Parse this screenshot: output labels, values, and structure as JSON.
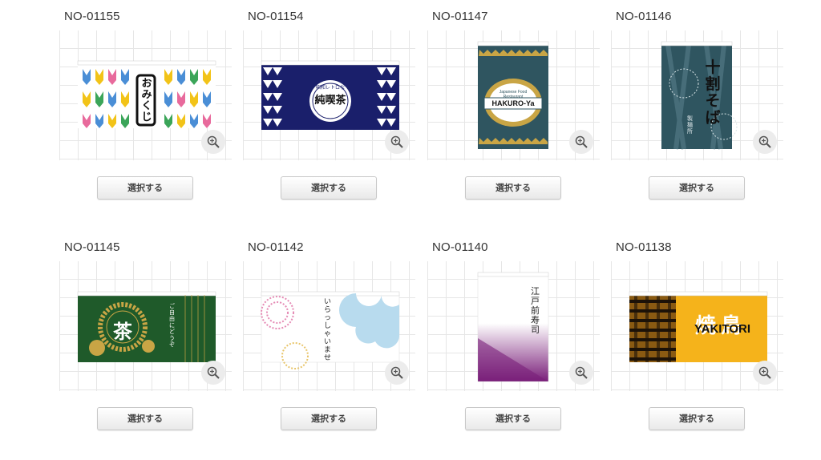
{
  "button_label": "選択する",
  "items": [
    {
      "code": "NO-01155",
      "banner_text": "おみくじ"
    },
    {
      "code": "NO-01154",
      "banner_text": "純喫茶",
      "banner_subtext": "昭和レトロな"
    },
    {
      "code": "NO-01147",
      "banner_text": "HAKURO-Ya",
      "banner_subtext": "Japanese Food Restaurant"
    },
    {
      "code": "NO-01146",
      "banner_text": "十割そば",
      "banner_subtext": "製麺所"
    },
    {
      "code": "NO-01145",
      "banner_text": "茶",
      "banner_subtext": "ご自由にどうぞ"
    },
    {
      "code": "NO-01142",
      "banner_text": "いらっしゃいませ"
    },
    {
      "code": "NO-01140",
      "banner_text": "江戸前寿司"
    },
    {
      "code": "NO-01138",
      "banner_text": "YAKITORI",
      "banner_subtext": "焼鳥"
    }
  ],
  "colors": {
    "navy": "#1a1f6b",
    "teal": "#2f5560",
    "green": "#1f5a2a",
    "gold": "#c9a545",
    "purple": "#7a1f7a",
    "yellow": "#f5b31b"
  }
}
